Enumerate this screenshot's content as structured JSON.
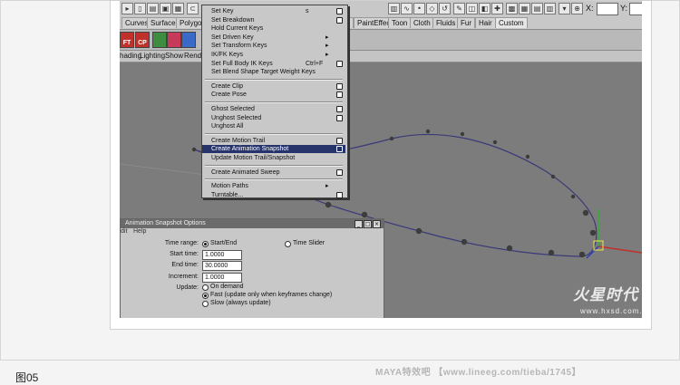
{
  "toolbar": {
    "x_label": "X:",
    "y_label": "Y:"
  },
  "shelf_tabs": [
    "Curves",
    "Surfaces",
    "Polygons",
    "g",
    "PaintEffects",
    "Toon",
    "Cloth",
    "Fluids",
    "Fur",
    "Hair",
    "Custom"
  ],
  "shelf_active": "Custom",
  "shelf_icon_text": [
    "FT",
    "CP"
  ],
  "panel_menu": [
    "hading",
    "Lighting",
    "Show",
    "Render"
  ],
  "animate_menu": {
    "items": [
      {
        "label": "Set Key",
        "shortcut": "s",
        "option": true
      },
      {
        "label": "Set Breakdown",
        "option": true
      },
      {
        "label": "Hold Current Keys"
      },
      {
        "label": "Set Driven Key",
        "submenu": true
      },
      {
        "label": "Set Transform Keys",
        "submenu": true
      },
      {
        "label": "IK/FK Keys",
        "submenu": true
      },
      {
        "label": "Set Full Body IK Keys",
        "shortcut": "Ctrl+F",
        "option": true
      },
      {
        "label": "Set Blend Shape Target Weight Keys"
      },
      {
        "sep": true
      },
      {
        "label": "Create Clip",
        "option": true
      },
      {
        "label": "Create Pose",
        "option": true
      },
      {
        "sep": true
      },
      {
        "label": "Ghost Selected",
        "option": true
      },
      {
        "label": "Unghost Selected",
        "option": true
      },
      {
        "label": "Unghost All"
      },
      {
        "sep": true
      },
      {
        "label": "Create Motion Trail",
        "option": true
      },
      {
        "label": "Create Animation Snapshot",
        "option": true,
        "highlighted": true
      },
      {
        "label": "Update Motion Trail/Snapshot"
      },
      {
        "sep": true
      },
      {
        "label": "Create Animated Sweep",
        "option": true
      },
      {
        "sep": true
      },
      {
        "label": "Motion Paths",
        "submenu": true
      },
      {
        "label": "Turntable...",
        "option": true
      }
    ]
  },
  "snapshot_options": {
    "title": "Animation Snapshot Options",
    "menu": [
      "dit",
      "Help"
    ],
    "time_range_label": "Time range:",
    "time_range_start_end": "Start/End",
    "time_range_time_slider": "Time Slider",
    "start_time_label": "Start time:",
    "start_time": "1.0000",
    "end_time_label": "End time:",
    "end_time": "30.0000",
    "increment_label": "Increment:",
    "increment": "1.0000",
    "update_label": "Update:",
    "update_on_demand": "On demand",
    "update_fast": "Fast (update only when keyframes change)",
    "update_slow": "Slow (always update)"
  },
  "watermark": {
    "logo": "火星时代",
    "url": "www.hxsd.com.cn"
  },
  "caption": "图05",
  "source_credit": "MAYA特效吧 【www.lineeg.com/tieba/1745】",
  "colors": {
    "menu_highlight": "#26346b",
    "viewport": "#7c7c7c",
    "curve": "#3a3a78",
    "snapshot_point": "#3c3c3c"
  }
}
